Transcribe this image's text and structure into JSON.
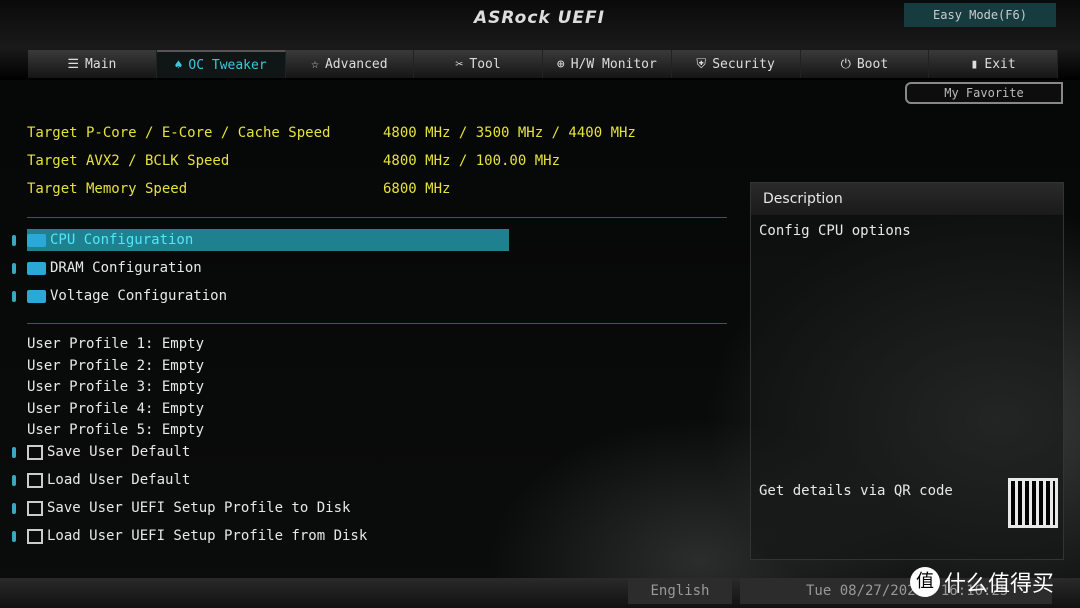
{
  "header": {
    "logo": "ASRock UEFI",
    "easy_mode": "Easy Mode(F6)",
    "my_favorite": "My Favorite"
  },
  "tabs": [
    {
      "label": "Main",
      "icon": "list-icon"
    },
    {
      "label": "OC Tweaker",
      "icon": "flame-icon",
      "active": true
    },
    {
      "label": "Advanced",
      "icon": "star-icon"
    },
    {
      "label": "Tool",
      "icon": "tools-icon"
    },
    {
      "label": "H/W Monitor",
      "icon": "monitor-icon"
    },
    {
      "label": "Security",
      "icon": "shield-icon"
    },
    {
      "label": "Boot",
      "icon": "power-icon"
    },
    {
      "label": "Exit",
      "icon": "exit-icon"
    }
  ],
  "info": [
    {
      "label": "Target P-Core / E-Core / Cache Speed",
      "value": "4800 MHz / 3500 MHz / 4400 MHz"
    },
    {
      "label": "Target AVX2 / BCLK Speed",
      "value": "4800 MHz / 100.00 MHz"
    },
    {
      "label": "Target Memory Speed",
      "value": "6800 MHz"
    }
  ],
  "menu": [
    "CPU Configuration",
    "DRAM Configuration",
    "Voltage Configuration"
  ],
  "profiles": [
    "User Profile 1: Empty",
    "User Profile 2: Empty",
    "User Profile 3: Empty",
    "User Profile 4: Empty",
    "User Profile 5: Empty"
  ],
  "actions": [
    "Save User Default",
    "Load User Default",
    "Save User UEFI Setup Profile to Disk",
    "Load User UEFI Setup Profile from Disk"
  ],
  "description": {
    "title": "Description",
    "text": "Config CPU options",
    "qr_text": "Get details via QR code"
  },
  "footer": {
    "language": "English",
    "datetime": "Tue 08/27/2024, 16:10:25"
  },
  "watermark": "什么值得买",
  "colors": {
    "accent": "#1f8190",
    "highlight_text": "#4fe8f8",
    "info_text": "#e6e23a"
  }
}
